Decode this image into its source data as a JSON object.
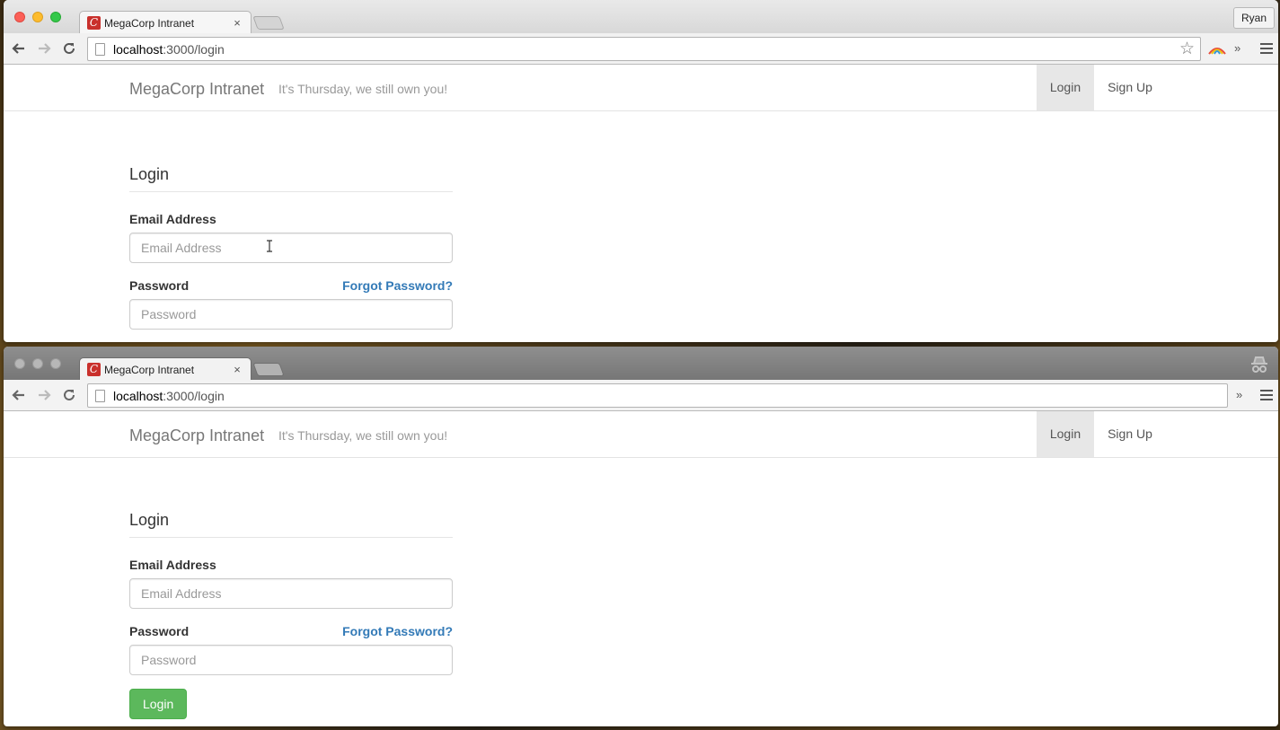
{
  "colors": {
    "primary_link": "#337ab7",
    "success_button": "#5cb85c",
    "nav_active_bg": "#e7e7e7"
  },
  "window_top": {
    "tab": {
      "title": "MegaCorp Intranet",
      "favicon": "C",
      "close": "×"
    },
    "profile": "Ryan",
    "url": {
      "host": "localhost",
      "rest": ":3000/login"
    },
    "overflow": "»",
    "page": {
      "brand": "MegaCorp Intranet",
      "tagline": "It's Thursday, we still own you!",
      "nav": {
        "login": "Login",
        "signup": "Sign Up"
      },
      "form": {
        "title": "Login",
        "email_label": "Email Address",
        "email_placeholder": "Email Address",
        "email_value": "",
        "password_label": "Password",
        "forgot": "Forgot Password?",
        "password_placeholder": "Password",
        "password_value": ""
      }
    }
  },
  "window_bottom": {
    "tab": {
      "title": "MegaCorp Intranet",
      "favicon": "C",
      "close": "×"
    },
    "url": {
      "host": "localhost",
      "rest": ":3000/login"
    },
    "overflow": "»",
    "page": {
      "brand": "MegaCorp Intranet",
      "tagline": "It's Thursday, we still own you!",
      "nav": {
        "login": "Login",
        "signup": "Sign Up"
      },
      "form": {
        "title": "Login",
        "email_label": "Email Address",
        "email_placeholder": "Email Address",
        "email_value": "",
        "password_label": "Password",
        "forgot": "Forgot Password?",
        "password_placeholder": "Password",
        "password_value": "",
        "submit": "Login"
      }
    }
  }
}
